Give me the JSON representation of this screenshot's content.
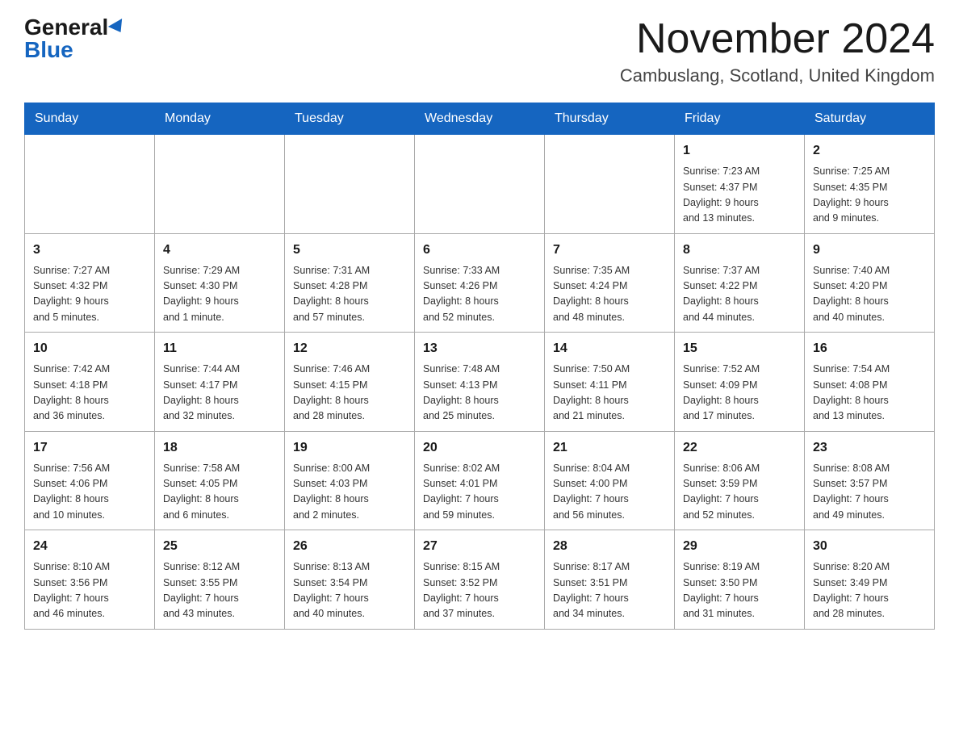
{
  "logo": {
    "general": "General",
    "blue": "Blue"
  },
  "title": "November 2024",
  "location": "Cambuslang, Scotland, United Kingdom",
  "days_of_week": [
    "Sunday",
    "Monday",
    "Tuesday",
    "Wednesday",
    "Thursday",
    "Friday",
    "Saturday"
  ],
  "weeks": [
    [
      {
        "day": "",
        "info": ""
      },
      {
        "day": "",
        "info": ""
      },
      {
        "day": "",
        "info": ""
      },
      {
        "day": "",
        "info": ""
      },
      {
        "day": "",
        "info": ""
      },
      {
        "day": "1",
        "info": "Sunrise: 7:23 AM\nSunset: 4:37 PM\nDaylight: 9 hours\nand 13 minutes."
      },
      {
        "day": "2",
        "info": "Sunrise: 7:25 AM\nSunset: 4:35 PM\nDaylight: 9 hours\nand 9 minutes."
      }
    ],
    [
      {
        "day": "3",
        "info": "Sunrise: 7:27 AM\nSunset: 4:32 PM\nDaylight: 9 hours\nand 5 minutes."
      },
      {
        "day": "4",
        "info": "Sunrise: 7:29 AM\nSunset: 4:30 PM\nDaylight: 9 hours\nand 1 minute."
      },
      {
        "day": "5",
        "info": "Sunrise: 7:31 AM\nSunset: 4:28 PM\nDaylight: 8 hours\nand 57 minutes."
      },
      {
        "day": "6",
        "info": "Sunrise: 7:33 AM\nSunset: 4:26 PM\nDaylight: 8 hours\nand 52 minutes."
      },
      {
        "day": "7",
        "info": "Sunrise: 7:35 AM\nSunset: 4:24 PM\nDaylight: 8 hours\nand 48 minutes."
      },
      {
        "day": "8",
        "info": "Sunrise: 7:37 AM\nSunset: 4:22 PM\nDaylight: 8 hours\nand 44 minutes."
      },
      {
        "day": "9",
        "info": "Sunrise: 7:40 AM\nSunset: 4:20 PM\nDaylight: 8 hours\nand 40 minutes."
      }
    ],
    [
      {
        "day": "10",
        "info": "Sunrise: 7:42 AM\nSunset: 4:18 PM\nDaylight: 8 hours\nand 36 minutes."
      },
      {
        "day": "11",
        "info": "Sunrise: 7:44 AM\nSunset: 4:17 PM\nDaylight: 8 hours\nand 32 minutes."
      },
      {
        "day": "12",
        "info": "Sunrise: 7:46 AM\nSunset: 4:15 PM\nDaylight: 8 hours\nand 28 minutes."
      },
      {
        "day": "13",
        "info": "Sunrise: 7:48 AM\nSunset: 4:13 PM\nDaylight: 8 hours\nand 25 minutes."
      },
      {
        "day": "14",
        "info": "Sunrise: 7:50 AM\nSunset: 4:11 PM\nDaylight: 8 hours\nand 21 minutes."
      },
      {
        "day": "15",
        "info": "Sunrise: 7:52 AM\nSunset: 4:09 PM\nDaylight: 8 hours\nand 17 minutes."
      },
      {
        "day": "16",
        "info": "Sunrise: 7:54 AM\nSunset: 4:08 PM\nDaylight: 8 hours\nand 13 minutes."
      }
    ],
    [
      {
        "day": "17",
        "info": "Sunrise: 7:56 AM\nSunset: 4:06 PM\nDaylight: 8 hours\nand 10 minutes."
      },
      {
        "day": "18",
        "info": "Sunrise: 7:58 AM\nSunset: 4:05 PM\nDaylight: 8 hours\nand 6 minutes."
      },
      {
        "day": "19",
        "info": "Sunrise: 8:00 AM\nSunset: 4:03 PM\nDaylight: 8 hours\nand 2 minutes."
      },
      {
        "day": "20",
        "info": "Sunrise: 8:02 AM\nSunset: 4:01 PM\nDaylight: 7 hours\nand 59 minutes."
      },
      {
        "day": "21",
        "info": "Sunrise: 8:04 AM\nSunset: 4:00 PM\nDaylight: 7 hours\nand 56 minutes."
      },
      {
        "day": "22",
        "info": "Sunrise: 8:06 AM\nSunset: 3:59 PM\nDaylight: 7 hours\nand 52 minutes."
      },
      {
        "day": "23",
        "info": "Sunrise: 8:08 AM\nSunset: 3:57 PM\nDaylight: 7 hours\nand 49 minutes."
      }
    ],
    [
      {
        "day": "24",
        "info": "Sunrise: 8:10 AM\nSunset: 3:56 PM\nDaylight: 7 hours\nand 46 minutes."
      },
      {
        "day": "25",
        "info": "Sunrise: 8:12 AM\nSunset: 3:55 PM\nDaylight: 7 hours\nand 43 minutes."
      },
      {
        "day": "26",
        "info": "Sunrise: 8:13 AM\nSunset: 3:54 PM\nDaylight: 7 hours\nand 40 minutes."
      },
      {
        "day": "27",
        "info": "Sunrise: 8:15 AM\nSunset: 3:52 PM\nDaylight: 7 hours\nand 37 minutes."
      },
      {
        "day": "28",
        "info": "Sunrise: 8:17 AM\nSunset: 3:51 PM\nDaylight: 7 hours\nand 34 minutes."
      },
      {
        "day": "29",
        "info": "Sunrise: 8:19 AM\nSunset: 3:50 PM\nDaylight: 7 hours\nand 31 minutes."
      },
      {
        "day": "30",
        "info": "Sunrise: 8:20 AM\nSunset: 3:49 PM\nDaylight: 7 hours\nand 28 minutes."
      }
    ]
  ]
}
